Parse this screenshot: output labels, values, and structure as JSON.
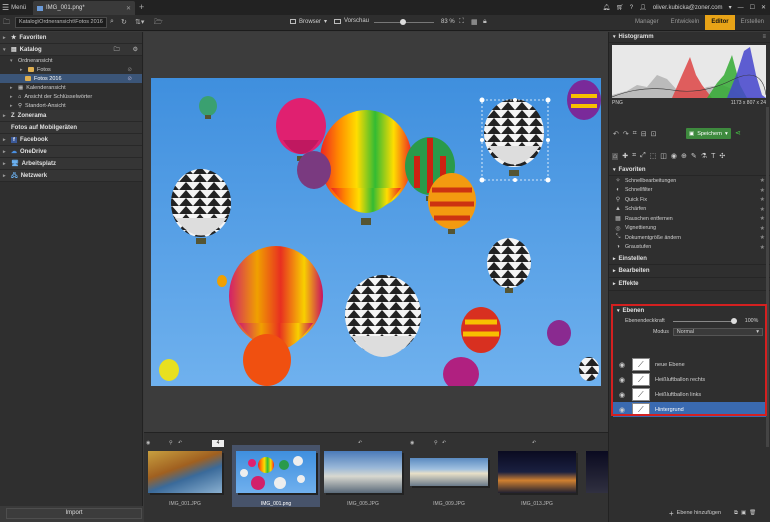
{
  "titlebar": {
    "menu_label": "Menü",
    "tab_title": "IMG_001.png*",
    "user_email": "oliver.kubicka@zoner.com"
  },
  "toolbar": {
    "path": "Katalog\\Ordneransicht\\Fotos 2016",
    "browser_label": "Browser",
    "preview_label": "Vorschau",
    "zoom": "83 %",
    "modes": [
      "Manager",
      "Entwickeln",
      "Editor",
      "Erstellen"
    ],
    "active_mode": "Editor"
  },
  "leftpanel": {
    "sections": {
      "favoriten": "Favoriten",
      "katalog": "Katalog",
      "zonerama": "Zonerama",
      "mobile": "Fotos auf Mobilgeräten",
      "facebook": "Facebook",
      "onedrive": "OneDrive",
      "arbeitsplatz": "Arbeitsplatz",
      "netzwerk": "Netzwerk"
    },
    "katalog_items": {
      "ordneransicht": "Ordneransicht",
      "fotos": "Fotos",
      "fotos2016": "Fotos 2016",
      "kalender": "Kalenderansicht",
      "schluessel": "Ansicht der Schlüsselwörter",
      "standort": "Standort-Ansicht"
    },
    "import_label": "Import"
  },
  "filmstrip": {
    "badge": "4",
    "thumbs": [
      {
        "name": "IMG_001.JPG"
      },
      {
        "name": "IMG_001.png"
      },
      {
        "name": "IMG_005.JPG"
      },
      {
        "name": "IMG_009.JPG"
      },
      {
        "name": "IMG_013.JPG"
      }
    ]
  },
  "rightpanel": {
    "histogram_title": "Histogramm",
    "format": "PNG",
    "dimensions": "1173 x 807 x 24",
    "save_label": "Speichern",
    "favoriten_title": "Favoriten",
    "favoriten_items": [
      "Schnellbearbeitungen",
      "Schnellfilter",
      "Quick Fix",
      "Schärfen",
      "Rauschen entfernen",
      "Vignettierung",
      "Dokumentgröße ändern",
      "Graustufen"
    ],
    "collapsed_sections": [
      "Einstellen",
      "Bearbeiten",
      "Effekte"
    ],
    "ebenen_title": "Ebenen",
    "opacity_label": "Ebenendeckkraft",
    "opacity_value": "100%",
    "mode_label": "Modus",
    "mode_value": "Normal",
    "layers": [
      {
        "name": "neue Ebene"
      },
      {
        "name": "Heißluftballon rechts"
      },
      {
        "name": "Heißluftballon links"
      },
      {
        "name": "Hintergrund"
      }
    ],
    "add_layer_label": "Ebene hinzufügen"
  },
  "colors": {
    "accent": "#e8a317",
    "selection": "#3a6ab0",
    "highlight_box": "#d42020"
  }
}
